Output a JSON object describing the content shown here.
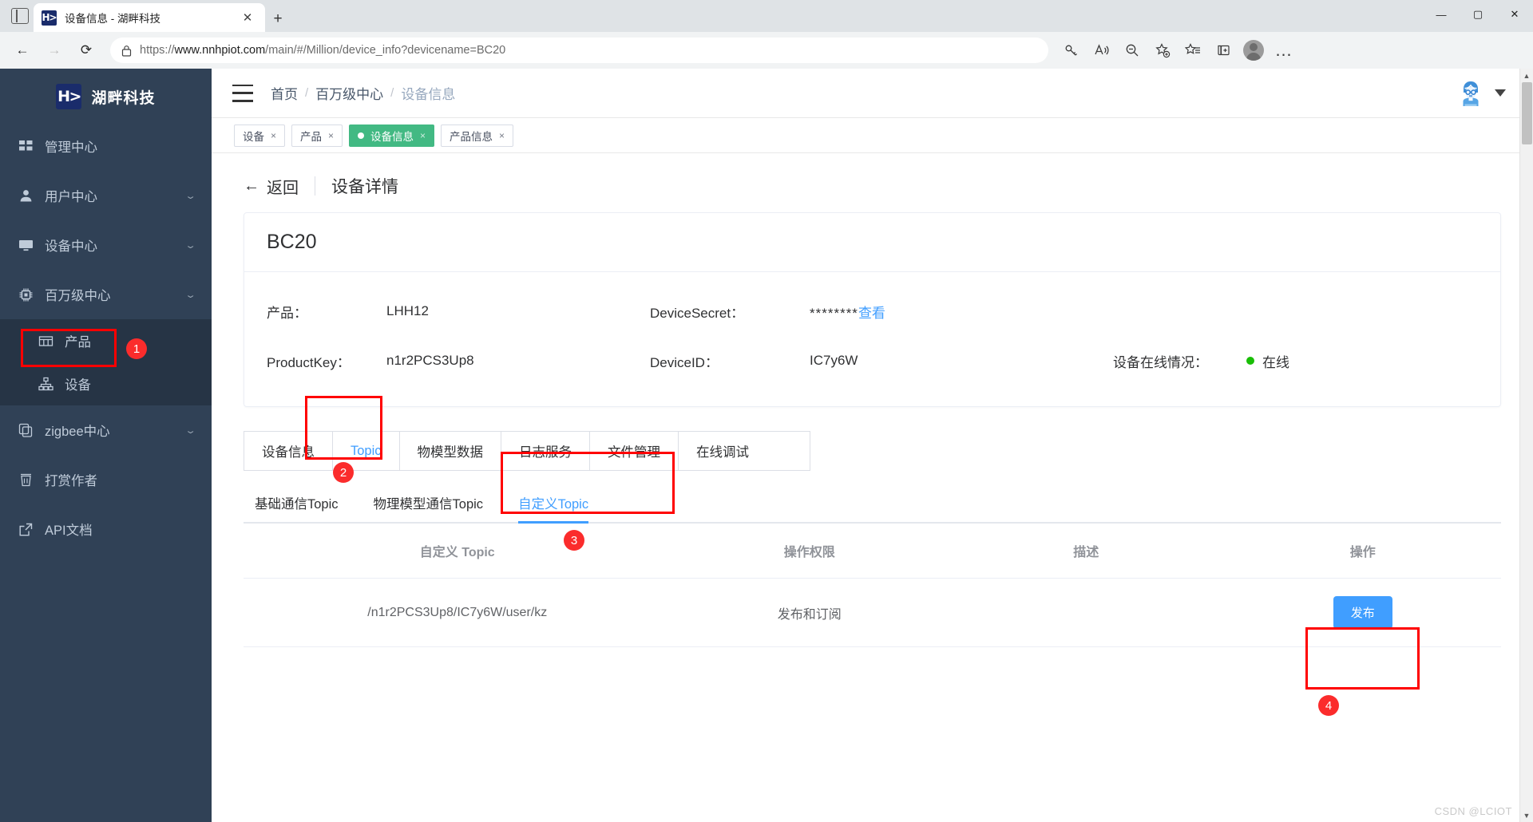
{
  "browser": {
    "tab_title": "设备信息 - 湖畔科技",
    "favicon_text": "H>",
    "new_tab_label": "+",
    "close_label": "✕",
    "url": "https://www.nnhpiot.com/main/#/Million/device_info?devicename=BC20",
    "url_scheme": "https://",
    "url_host": "www.nnhpiot.com",
    "url_path": "/main/#/Million/device_info?devicename=BC20",
    "nav": {
      "back": "←",
      "forward": "→",
      "reload": "⟳"
    },
    "window": {
      "minimize": "—",
      "maximize": "▢",
      "close": "✕"
    },
    "toolbar_icons": [
      "key-icon",
      "read-aloud-icon",
      "zoom-out-icon",
      "add-favorite-icon",
      "favorites-icon",
      "collections-icon",
      "profile-icon",
      "settings-more-icon"
    ],
    "more_label": "…"
  },
  "sidebar": {
    "brand": {
      "logo": "H>",
      "name": "湖畔科技"
    },
    "items": [
      {
        "label": "管理中心",
        "icon": "dashboard-icon",
        "expandable": false
      },
      {
        "label": "用户中心",
        "icon": "user-icon",
        "expandable": true
      },
      {
        "label": "设备中心",
        "icon": "monitor-icon",
        "expandable": true
      },
      {
        "label": "百万级中心",
        "icon": "chip-icon",
        "expandable": true
      }
    ],
    "sub_items": [
      {
        "label": "产品",
        "icon": "grid-icon"
      },
      {
        "label": "设备",
        "icon": "sitemap-icon"
      }
    ],
    "items_bottom": [
      {
        "label": "zigbee中心",
        "icon": "copy-icon",
        "expandable": true
      },
      {
        "label": "打赏作者",
        "icon": "cup-icon",
        "expandable": false
      },
      {
        "label": "API文档",
        "icon": "external-link-icon",
        "expandable": false
      }
    ],
    "arrow_glyph": "⌄"
  },
  "topbar": {
    "hamburger": "menu-fold-icon",
    "breadcrumb": [
      "首页",
      "百万级中心",
      "设备信息"
    ],
    "separator": "/",
    "avatar": "user-avatar-icon",
    "caret": "caret-down-icon"
  },
  "tagbar": {
    "tags": [
      {
        "label": "设备",
        "active": false
      },
      {
        "label": "产品",
        "active": false
      },
      {
        "label": "设备信息",
        "active": true
      },
      {
        "label": "产品信息",
        "active": false
      }
    ],
    "close_glyph": "×"
  },
  "page": {
    "back_label": "返回",
    "back_arrow": "←",
    "title": "设备详情"
  },
  "device_card": {
    "name": "BC20",
    "rows": [
      {
        "label": "产品：",
        "value": "LHH12"
      },
      {
        "label": "ProductKey：",
        "value": "n1r2PCS3Up8"
      }
    ],
    "secret_label": "DeviceSecret：",
    "secret_mask": "********",
    "secret_link": "查看",
    "device_id_label": "DeviceID：",
    "device_id_value": "IC7y6W",
    "online_label": "设备在线情况：",
    "online_value": "在线",
    "online_color": "#19be06"
  },
  "main_tabs": [
    {
      "label": "设备信息",
      "active": false
    },
    {
      "label": "Topic",
      "active": true
    },
    {
      "label": "物模型数据",
      "active": false
    },
    {
      "label": "日志服务",
      "active": false
    },
    {
      "label": "文件管理",
      "active": false
    },
    {
      "label": "在线调试",
      "active": false
    }
  ],
  "sub_tabs": [
    {
      "label": "基础通信Topic",
      "active": false
    },
    {
      "label": "物理模型通信Topic",
      "active": false
    },
    {
      "label": "自定义Topic",
      "active": true
    }
  ],
  "topic_table": {
    "headers": [
      "自定义 Topic",
      "操作权限",
      "描述",
      "操作"
    ],
    "rows": [
      {
        "topic": "/n1r2PCS3Up8/IC7y6W/user/kz",
        "permission": "发布和订阅",
        "description": "",
        "action": "发布"
      }
    ]
  },
  "annotations": [
    {
      "num": "1",
      "target": "sidebar-device-item"
    },
    {
      "num": "2",
      "target": "main-tab-topic"
    },
    {
      "num": "3",
      "target": "sub-tab-custom-topic"
    },
    {
      "num": "4",
      "target": "publish-button"
    }
  ],
  "watermark": "CSDN @LCIOT",
  "colors": {
    "accent_blue": "#409eff",
    "sidebar_bg": "#304156",
    "tag_active_green": "#42b983",
    "online_green": "#19be06",
    "annotation_red": "#ff0000"
  }
}
